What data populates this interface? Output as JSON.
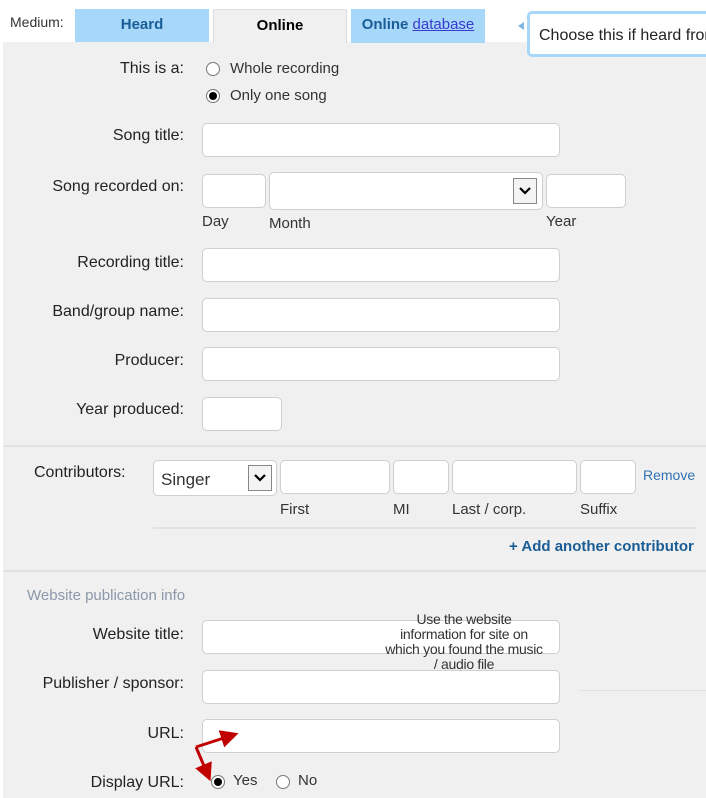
{
  "header": {
    "medium_label": "Medium:",
    "tabs": [
      {
        "label": "Heard",
        "active": false
      },
      {
        "label": "Online",
        "active": true
      },
      {
        "label": "Online",
        "link": "database",
        "active": false
      }
    ],
    "tooltip": "Choose this if heard from"
  },
  "form": {
    "this_is_a": {
      "label": "This is a:",
      "options": [
        {
          "label": "Whole recording",
          "checked": false
        },
        {
          "label": "Only one song",
          "checked": true
        }
      ]
    },
    "song_title": {
      "label": "Song title:",
      "value": ""
    },
    "song_recorded_on": {
      "label": "Song recorded on:",
      "day": {
        "value": "",
        "sublabel": "Day"
      },
      "month": {
        "value": "",
        "sublabel": "Month"
      },
      "year": {
        "value": "",
        "sublabel": "Year"
      }
    },
    "recording_title": {
      "label": "Recording title:",
      "value": ""
    },
    "band_group_name": {
      "label": "Band/group name:",
      "value": ""
    },
    "producer": {
      "label": "Producer:",
      "value": ""
    },
    "year_produced": {
      "label": "Year produced:",
      "value": ""
    },
    "contributors": {
      "label": "Contributors:",
      "rows": [
        {
          "role": "Singer",
          "first": {
            "value": "",
            "sublabel": "First"
          },
          "mi": {
            "value": "",
            "sublabel": "MI"
          },
          "last": {
            "value": "",
            "sublabel": "Last / corp."
          },
          "suffix": {
            "value": "",
            "sublabel": "Suffix"
          },
          "remove_label": "Remove"
        }
      ],
      "add_label": "+ Add another contributor"
    },
    "website": {
      "heading": "Website publication info",
      "website_title": {
        "label": "Website title:",
        "value": ""
      },
      "publisher": {
        "label": "Publisher / sponsor:",
        "value": ""
      },
      "url": {
        "label": "URL:",
        "value": ""
      },
      "display_url": {
        "label": "Display URL:",
        "options": [
          {
            "label": "Yes",
            "checked": true
          },
          {
            "label": "No",
            "checked": false
          }
        ]
      }
    }
  },
  "annotation": {
    "text": "Use the website information for site on which you found the music / audio file",
    "arrow_color": "#c00000"
  },
  "colors": {
    "tab_blue": "#a7d7f9",
    "tab_text": "#1a5d96",
    "form_bg": "#f0f0f0",
    "link": "#2f72b3"
  }
}
